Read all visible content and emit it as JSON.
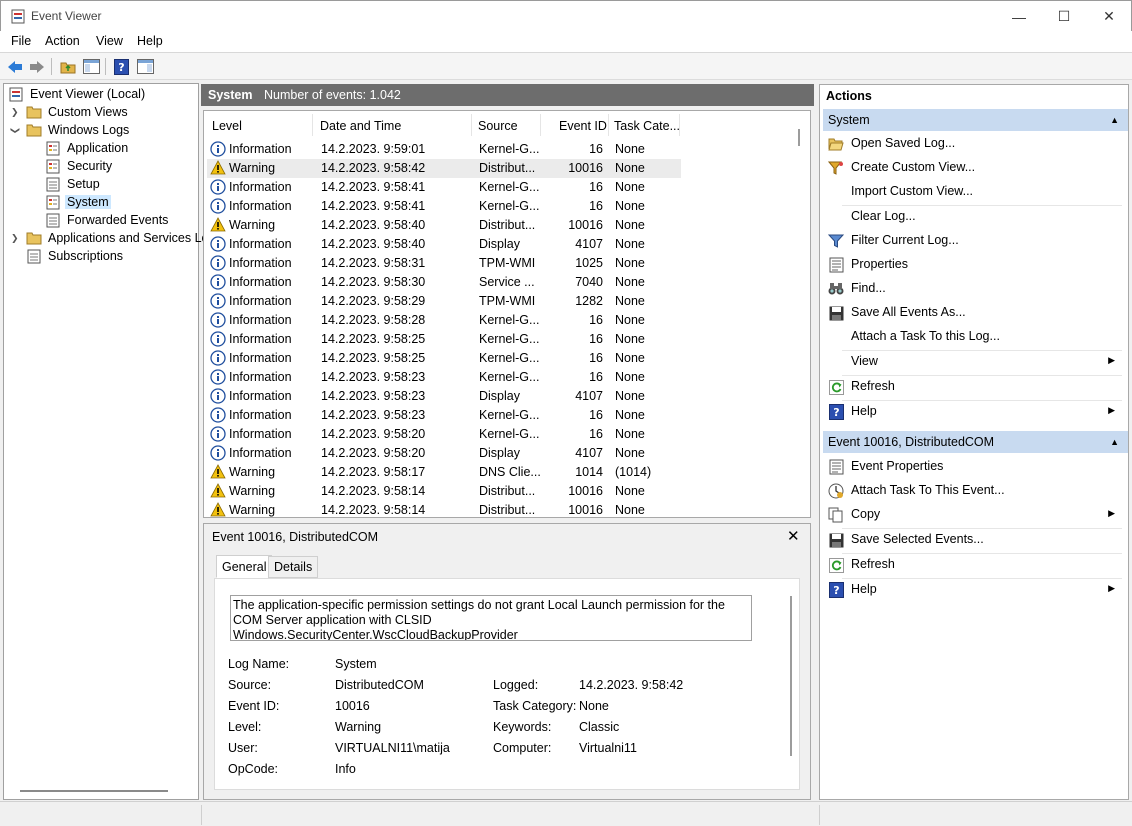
{
  "window": {
    "title": "Event Viewer",
    "min_glyph": "—",
    "max_glyph": "☐",
    "close_glyph": "✕"
  },
  "menu": [
    "File",
    "Action",
    "View",
    "Help"
  ],
  "tree": {
    "root": "Event Viewer (Local)",
    "custom_views": "Custom Views",
    "windows_logs": "Windows Logs",
    "logs": [
      "Application",
      "Security",
      "Setup",
      "System",
      "Forwarded Events"
    ],
    "apps_services": "Applications and Services Lo",
    "subscriptions": "Subscriptions",
    "selected": "System"
  },
  "center": {
    "log_name": "System",
    "count_text": "Number of events: 1.042"
  },
  "columns": [
    "Level",
    "Date and Time",
    "Source",
    "Event ID",
    "Task Cate..."
  ],
  "events": [
    {
      "level": "Information",
      "date": "14.2.2023. 9:59:01",
      "source": "Kernel-G...",
      "id": "16",
      "cat": "None"
    },
    {
      "level": "Warning",
      "date": "14.2.2023. 9:58:42",
      "source": "Distribut...",
      "id": "10016",
      "cat": "None"
    },
    {
      "level": "Information",
      "date": "14.2.2023. 9:58:41",
      "source": "Kernel-G...",
      "id": "16",
      "cat": "None"
    },
    {
      "level": "Information",
      "date": "14.2.2023. 9:58:41",
      "source": "Kernel-G...",
      "id": "16",
      "cat": "None"
    },
    {
      "level": "Warning",
      "date": "14.2.2023. 9:58:40",
      "source": "Distribut...",
      "id": "10016",
      "cat": "None"
    },
    {
      "level": "Information",
      "date": "14.2.2023. 9:58:40",
      "source": "Display",
      "id": "4107",
      "cat": "None"
    },
    {
      "level": "Information",
      "date": "14.2.2023. 9:58:31",
      "source": "TPM-WMI",
      "id": "1025",
      "cat": "None"
    },
    {
      "level": "Information",
      "date": "14.2.2023. 9:58:30",
      "source": "Service ...",
      "id": "7040",
      "cat": "None"
    },
    {
      "level": "Information",
      "date": "14.2.2023. 9:58:29",
      "source": "TPM-WMI",
      "id": "1282",
      "cat": "None"
    },
    {
      "level": "Information",
      "date": "14.2.2023. 9:58:28",
      "source": "Kernel-G...",
      "id": "16",
      "cat": "None"
    },
    {
      "level": "Information",
      "date": "14.2.2023. 9:58:25",
      "source": "Kernel-G...",
      "id": "16",
      "cat": "None"
    },
    {
      "level": "Information",
      "date": "14.2.2023. 9:58:25",
      "source": "Kernel-G...",
      "id": "16",
      "cat": "None"
    },
    {
      "level": "Information",
      "date": "14.2.2023. 9:58:23",
      "source": "Kernel-G...",
      "id": "16",
      "cat": "None"
    },
    {
      "level": "Information",
      "date": "14.2.2023. 9:58:23",
      "source": "Display",
      "id": "4107",
      "cat": "None"
    },
    {
      "level": "Information",
      "date": "14.2.2023. 9:58:23",
      "source": "Kernel-G...",
      "id": "16",
      "cat": "None"
    },
    {
      "level": "Information",
      "date": "14.2.2023. 9:58:20",
      "source": "Kernel-G...",
      "id": "16",
      "cat": "None"
    },
    {
      "level": "Information",
      "date": "14.2.2023. 9:58:20",
      "source": "Display",
      "id": "4107",
      "cat": "None"
    },
    {
      "level": "Warning",
      "date": "14.2.2023. 9:58:17",
      "source": "DNS Clie...",
      "id": "1014",
      "cat": "(1014)"
    },
    {
      "level": "Warning",
      "date": "14.2.2023. 9:58:14",
      "source": "Distribut...",
      "id": "10016",
      "cat": "None"
    },
    {
      "level": "Warning",
      "date": "14.2.2023. 9:58:14",
      "source": "Distribut...",
      "id": "10016",
      "cat": "None"
    }
  ],
  "selected_event_index": 1,
  "detail": {
    "title": "Event 10016, DistributedCOM",
    "close_glyph": "✕",
    "tabs": [
      "General",
      "Details"
    ],
    "description_lines": [
      "The application-specific permission settings do not grant Local Launch permission for the",
      "COM Server application with CLSID",
      "Windows.SecurityCenter.WscCloudBackupProvider"
    ],
    "fields": {
      "log_name_label": "Log Name:",
      "log_name": "System",
      "source_label": "Source:",
      "source": "DistributedCOM",
      "logged_label": "Logged:",
      "logged": "14.2.2023. 9:58:42",
      "event_id_label": "Event ID:",
      "event_id": "10016",
      "task_cat_label": "Task Category:",
      "task_cat": "None",
      "level_label": "Level:",
      "level": "Warning",
      "keywords_label": "Keywords:",
      "keywords": "Classic",
      "user_label": "User:",
      "user": "VIRTUALNI11\\matija",
      "computer_label": "Computer:",
      "computer": "Virtualni11",
      "opcode_label": "OpCode:",
      "opcode": "Info"
    }
  },
  "actions": {
    "title": "Actions",
    "section1": "System",
    "section1_items": [
      {
        "label": "Open Saved Log...",
        "icon": "folder-open-icon"
      },
      {
        "label": "Create Custom View...",
        "icon": "filter-create-icon"
      },
      {
        "label": "Import Custom View...",
        "icon": ""
      },
      {
        "label": "Clear Log...",
        "icon": ""
      },
      {
        "label": "Filter Current Log...",
        "icon": "filter-icon"
      },
      {
        "label": "Properties",
        "icon": "properties-icon"
      },
      {
        "label": "Find...",
        "icon": "binoculars-icon"
      },
      {
        "label": "Save All Events As...",
        "icon": "save-icon"
      },
      {
        "label": "Attach a Task To this Log...",
        "icon": ""
      },
      {
        "label": "View",
        "icon": "",
        "submenu": true
      },
      {
        "label": "Refresh",
        "icon": "refresh-icon"
      },
      {
        "label": "Help",
        "icon": "help-icon",
        "submenu": true
      }
    ],
    "section2": "Event 10016, DistributedCOM",
    "section2_items": [
      {
        "label": "Event Properties",
        "icon": "properties-icon"
      },
      {
        "label": "Attach Task To This Event...",
        "icon": "task-icon"
      },
      {
        "label": "Copy",
        "icon": "copy-icon",
        "submenu": true
      },
      {
        "label": "Save Selected Events...",
        "icon": "save-icon"
      },
      {
        "label": "Refresh",
        "icon": "refresh-icon"
      },
      {
        "label": "Help",
        "icon": "help-icon",
        "submenu": true
      }
    ]
  },
  "colors": {
    "selection": "#cde8ff",
    "section_bg": "#c8daf0",
    "header_bg": "#6d6d6d",
    "warning": "#f2c10f",
    "info": "#1f4e9e"
  }
}
